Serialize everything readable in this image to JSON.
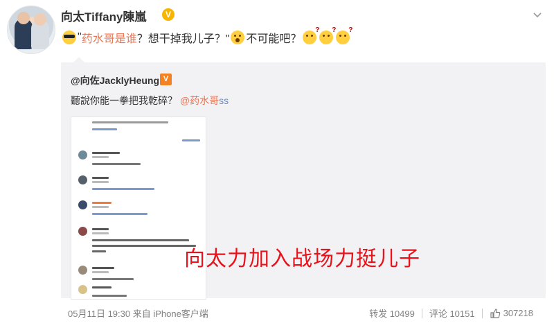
{
  "post": {
    "username": "向太Tiffany陳嵐",
    "verified_badge": "V",
    "text_part1": "\"",
    "text_link": "药水哥是谁",
    "text_part2": "？想干掉我儿子？\"",
    "text_part3": "不可能吧？",
    "emoji_icons": [
      "cool-emoji-icon",
      "shock-emoji-icon",
      "think-emoji-icon"
    ]
  },
  "quote": {
    "username": "@向佐JacklyHeung",
    "badge": "V",
    "text": "聽說你能一拳把我乾碎？",
    "mention": "@药水哥",
    "mention_suffix": "ss"
  },
  "overlay_text": "向太力加入战场力挺儿子",
  "footer": {
    "date": "05月11日 19:30 来自 iPhone客户端",
    "repost_label": "转发 10499",
    "comment_label": "评论 10151",
    "like_count": "307218"
  },
  "colors": {
    "accent_link": "#eb7350",
    "overlay_red": "#e8121b",
    "quote_bg": "#f2f2f5",
    "verified_gold": "#f7b500"
  }
}
